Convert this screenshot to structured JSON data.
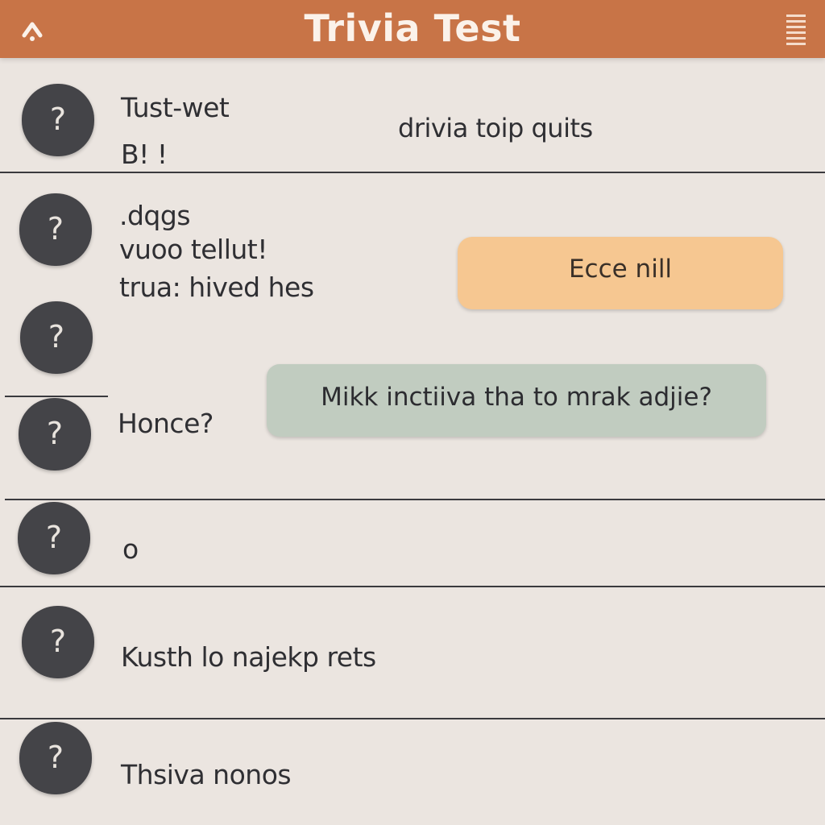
{
  "header": {
    "title": "Trivia Test",
    "back_icon": "back-arrow-icon",
    "menu_icon": "menu-lines-icon",
    "color": "#c87447"
  },
  "rows": [
    {
      "icon": "?",
      "lines": [
        "Tust-wet",
        "B! !"
      ],
      "side_text": "drivia toip quits"
    },
    {
      "icon": "?",
      "lines": [
        ".dqgs",
        "vuoo tellut!",
        "trua: hived hes"
      ]
    },
    {
      "icon": "?"
    },
    {
      "icon": "?",
      "lines": [
        "Honce?"
      ]
    },
    {
      "icon": "?",
      "lines": [
        "o"
      ]
    },
    {
      "icon": "?",
      "lines": [
        "Kusth lo najekp rets"
      ]
    },
    {
      "icon": "?",
      "lines": [
        "Thsiva nonos"
      ]
    }
  ],
  "answer_button": {
    "label": "Ecce nill",
    "color": "#f6c791"
  },
  "prompt_bubble": {
    "text": "Mikk inctiiva tha to mrak adjie?",
    "color": "#c1ccc0"
  }
}
